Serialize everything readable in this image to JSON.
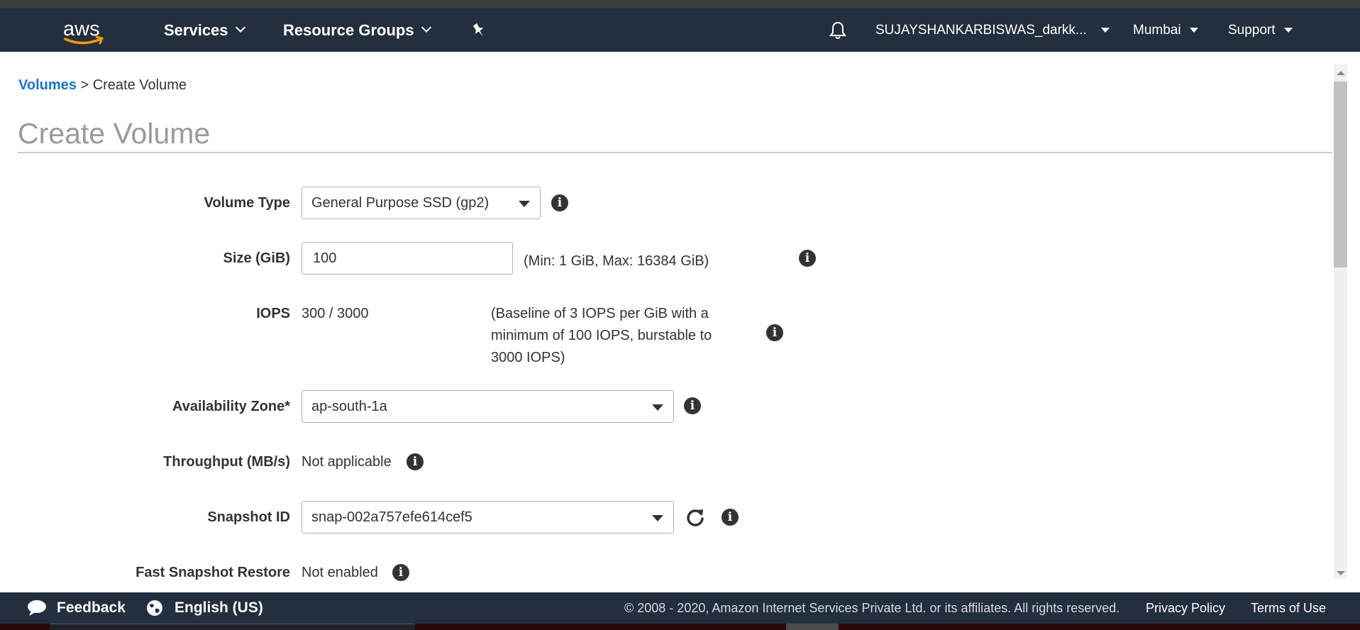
{
  "header": {
    "logo_text": "aws",
    "services_label": "Services",
    "resource_groups_label": "Resource Groups",
    "account_label": "SUJAYSHANKARBISWAS_darkk...",
    "region_label": "Mumbai",
    "support_label": "Support"
  },
  "breadcrumb": {
    "link": "Volumes",
    "separator": ">",
    "current": "Create Volume"
  },
  "page_title": "Create Volume",
  "form": {
    "volume_type": {
      "label": "Volume Type",
      "value": "General Purpose SSD (gp2)"
    },
    "size": {
      "label": "Size (GiB)",
      "value": "100",
      "hint": "(Min: 1 GiB, Max: 16384 GiB)"
    },
    "iops": {
      "label": "IOPS",
      "value": "300 / 3000",
      "hint_line1": "(Baseline of 3 IOPS per GiB with a",
      "hint_line2": "minimum of 100 IOPS, burstable to",
      "hint_line3": "3000 IOPS)"
    },
    "availability_zone": {
      "label": "Availability Zone*",
      "value": "ap-south-1a"
    },
    "throughput": {
      "label": "Throughput (MB/s)",
      "value": "Not applicable"
    },
    "snapshot_id": {
      "label": "Snapshot ID",
      "value": "snap-002a757efe614cef5"
    },
    "fast_snapshot_restore": {
      "label": "Fast Snapshot Restore",
      "value": "Not enabled"
    }
  },
  "footer": {
    "feedback_label": "Feedback",
    "language_label": "English (US)",
    "copyright": "© 2008 - 2020, Amazon Internet Services Private Ltd. or its affiliates. All rights reserved.",
    "privacy_label": "Privacy Policy",
    "terms_label": "Terms of Use"
  },
  "colors": {
    "nav_bg": "#232f3e",
    "link_blue": "#1a73c7",
    "aws_orange": "#ff9900"
  }
}
